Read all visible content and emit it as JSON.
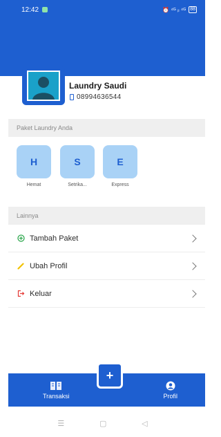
{
  "status_bar": {
    "time": "12:42",
    "indicators": "⏰ ⁴ᴳ ᵢₗ ⁴ᴳ",
    "battery": "88"
  },
  "profile": {
    "name": "Laundry Saudi",
    "phone": "08994636544"
  },
  "packages_section": {
    "title": "Paket Laundry Anda",
    "items": [
      {
        "letter": "H",
        "label": "Hemat"
      },
      {
        "letter": "S",
        "label": "Setrika..."
      },
      {
        "letter": "E",
        "label": "Express"
      }
    ]
  },
  "other_section": {
    "title": "Lainnya",
    "items": [
      {
        "label": "Tambah Paket",
        "icon": "plus-circle-icon",
        "color": "#2fa84f"
      },
      {
        "label": "Ubah Profil",
        "icon": "pencil-icon",
        "color": "#f2c200"
      },
      {
        "label": "Keluar",
        "icon": "logout-icon",
        "color": "#e53935"
      }
    ]
  },
  "bottom_nav": {
    "transaksi_label": "Transaksi",
    "profil_label": "Profil",
    "fab_label": "+"
  },
  "colors": {
    "primary": "#1e5fd0",
    "tile": "#a9d2f6"
  }
}
